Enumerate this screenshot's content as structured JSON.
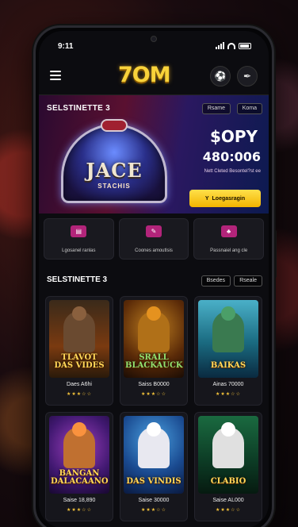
{
  "status": {
    "time": "9:11"
  },
  "app": {
    "logo": "7OM"
  },
  "icons": {
    "menu": "hamburger-icon",
    "profile": "soccer-ball-icon",
    "edit": "feather-pen-icon"
  },
  "hero": {
    "section_title": "SELSTINETTE 3",
    "chip1": "Rsame",
    "chip2": "Koma",
    "machine_title": "JACE",
    "machine_subtitle": "STACHIS",
    "amount_main": "$OPY",
    "amount_secondary": "480:006",
    "amount_note": "Nett Cleted Besontel?st ee",
    "cta_label": "Loegasragin",
    "cta_icon": "Y"
  },
  "quick": [
    {
      "label": "Lgosanel ranlas",
      "icon": "ticket-icon"
    },
    {
      "label": "Coones amoutlsis",
      "icon": "card-icon"
    },
    {
      "label": "Passnaiel ang cle",
      "icon": "chips-icon"
    }
  ],
  "games_section": {
    "title": "SELSTINETTE 3",
    "chip1": "Bsedes",
    "chip2": "Rseale"
  },
  "games": [
    {
      "name": "TLAVOT DAS VIDES",
      "stat": "Daes A6hi",
      "stars": "★★★☆☆"
    },
    {
      "name": "SRALL BLACKAUCK",
      "stat": "Saiss B0000",
      "stars": "★★★☆☆"
    },
    {
      "name": "BAIKAS",
      "stat": "Ainas 70000",
      "stars": "★★★☆☆"
    },
    {
      "name": "BANGAN DALACAANO",
      "stat": "Saise 18,890",
      "stars": "★★★☆☆"
    },
    {
      "name": "DAS VINDIS",
      "stat": "Saise 30000",
      "stars": "★★★☆☆"
    },
    {
      "name": "CLABIO",
      "stat": "Saise AL000",
      "stars": "★★★☆☆"
    }
  ],
  "colors": {
    "accent": "#f8d23a",
    "cta": "#f2b400",
    "icon_bg": "#b2247a"
  }
}
